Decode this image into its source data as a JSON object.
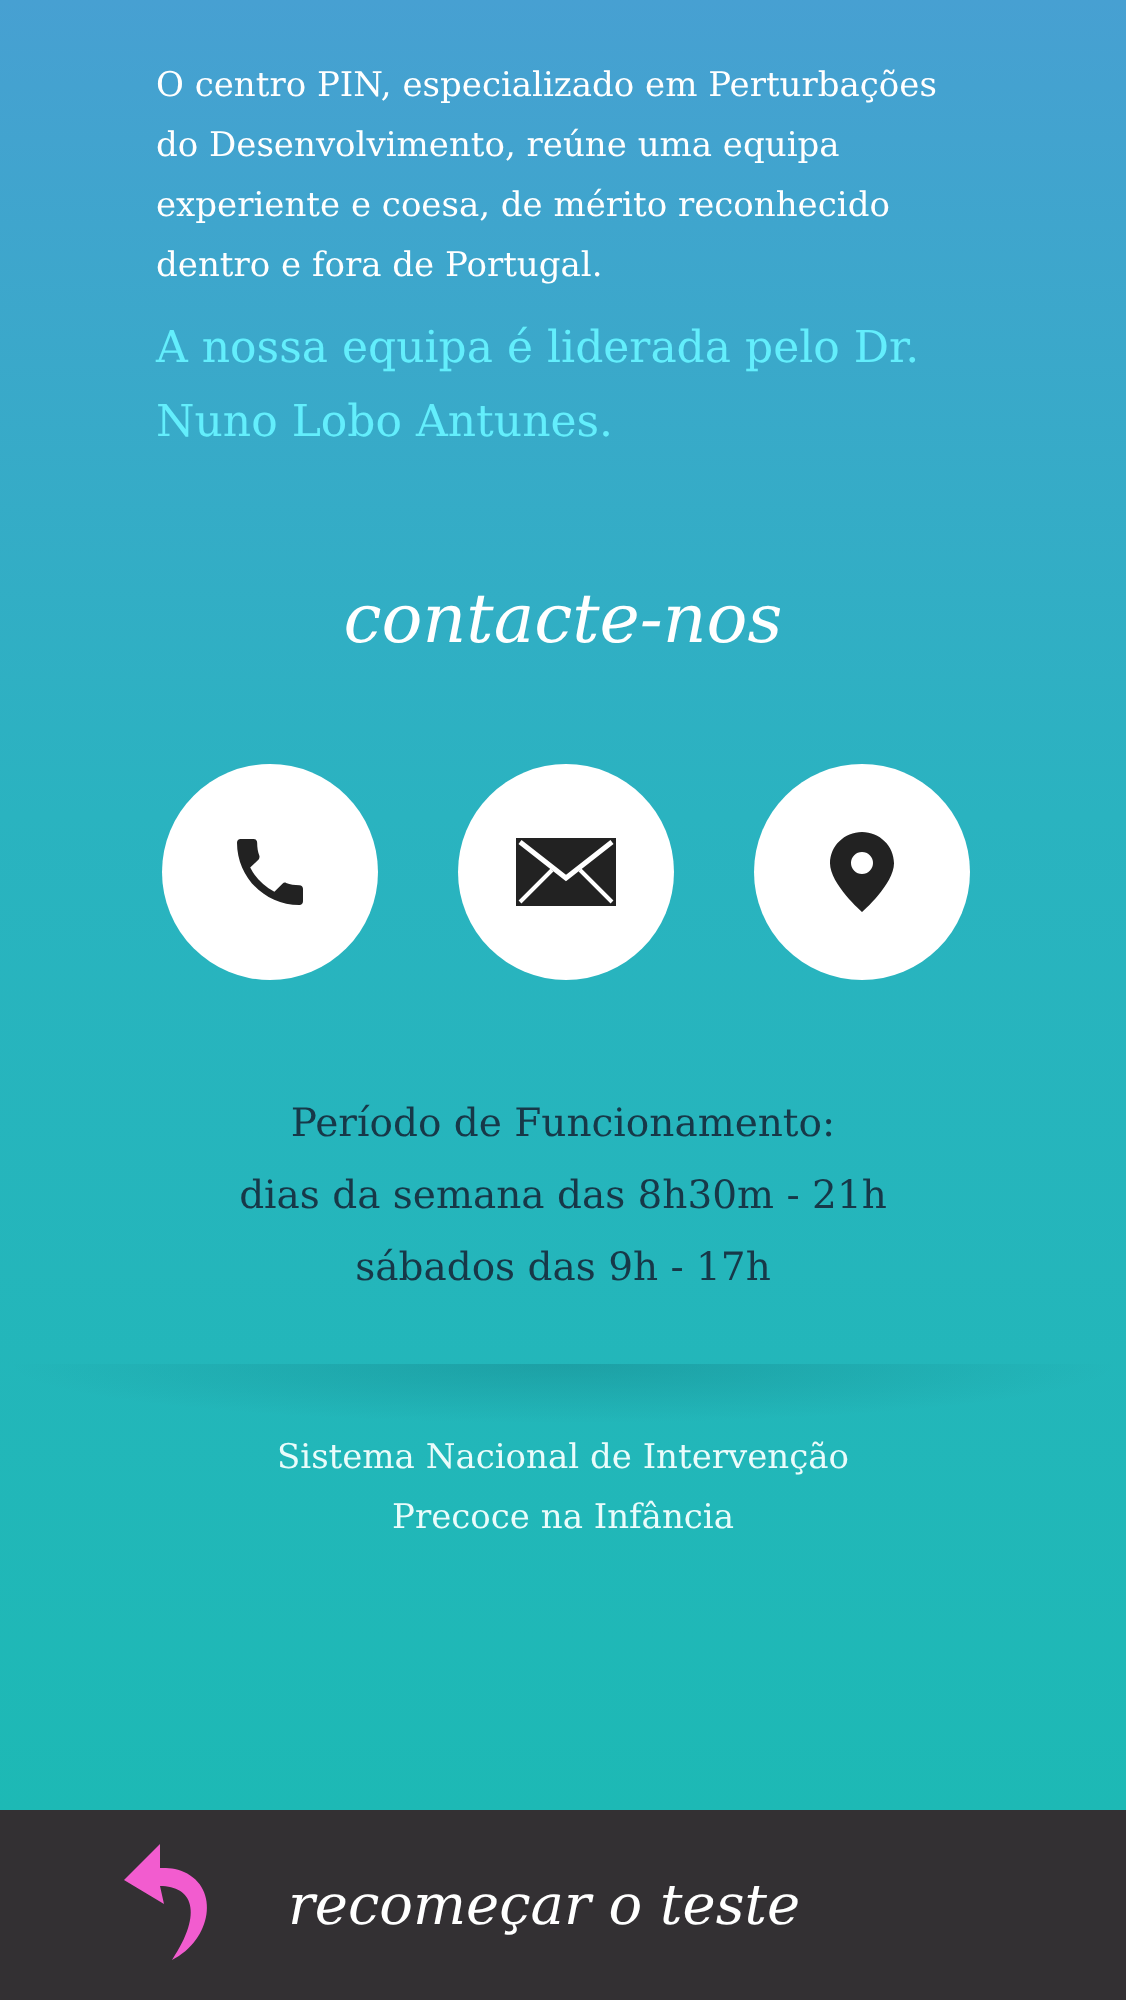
{
  "intro": "O centro PIN, especializado em Perturbações do Desenvolvimento, reúne uma equipa experiente e coesa, de mérito reconhecido dentro e fora de Portugal.",
  "highlight": "A nossa equipa é liderada pelo Dr. Nuno Lobo Antunes.",
  "contact_title": "contacte-nos",
  "contacts": [
    {
      "kind": "phone"
    },
    {
      "kind": "email"
    },
    {
      "kind": "location"
    }
  ],
  "hours": [
    "Período de Funcionamento:",
    "dias da semana das 8h30m - 21h",
    "sábados das 9h - 17h"
  ],
  "footer_text": [
    "Sistema Nacional de Intervenção",
    "Precoce na Infância"
  ],
  "bottom_bar": {
    "label": "recomeçar o teste"
  }
}
